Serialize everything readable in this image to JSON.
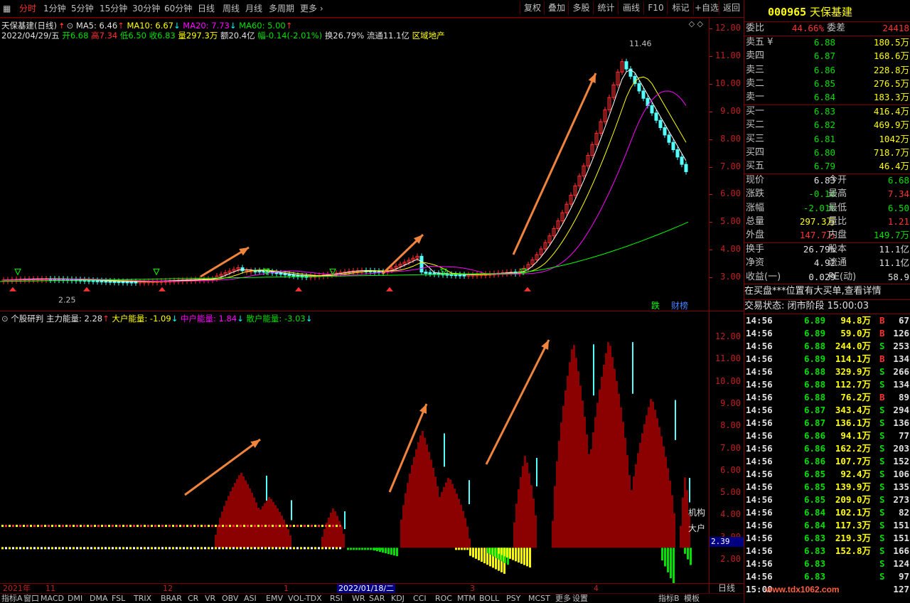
{
  "toolbar": {
    "tabs": [
      "分时",
      "1分钟",
      "5分钟",
      "15分钟",
      "30分钟",
      "60分钟",
      "日线",
      "周线",
      "月线",
      "多周期",
      "更多"
    ],
    "buttons": [
      "复权",
      "叠加",
      "多股",
      "统计",
      "画线",
      "F10",
      "标记",
      "+自选",
      "返回"
    ]
  },
  "main": {
    "title": "天保基建(日线)",
    "ma5": "MA5: 6.46",
    "ma10": "MA10: 6.67",
    "ma20": "MA20: 7.73",
    "ma60": "MA60: 5.00",
    "date": "2022/04/29/五",
    "open": "开6.68",
    "high": "高7.34",
    "low": "低6.50",
    "close": "收6.83",
    "vol": "量297.3万",
    "amount": "额20.4亿",
    "change": "幅-0.14(-2.01%)",
    "turnover": "换26.79%",
    "float": "流通11.1亿",
    "sector": "区域地产",
    "high_marker": "11.46",
    "low_marker": "2.25",
    "corner_labels": [
      "跌",
      "财榜"
    ]
  },
  "sub": {
    "title": "个股研判",
    "main_energy": "主力能量: 2.28",
    "big_energy": "大户能量: -1.09",
    "mid_energy": "中户能量: 1.84",
    "small_energy": "散户能量: -3.03",
    "label_jigou": "机构",
    "label_dahu": "大户",
    "current": "2.39"
  },
  "yaxis_main": [
    "12.00",
    "11.00",
    "10.00",
    "9.00",
    "8.00",
    "7.00",
    "6.00",
    "5.00",
    "4.00",
    "3.00"
  ],
  "yaxis_sub": [
    "12.00",
    "11.00",
    "10.00",
    "9.00",
    "8.00",
    "7.00",
    "6.00",
    "5.00",
    "4.00",
    "3.00",
    "2.00"
  ],
  "timebar": {
    "labels": [
      "2021年",
      "11",
      "12",
      "1",
      "2022/01/18/二",
      "3",
      "4"
    ],
    "period": "日线"
  },
  "bottom_tabs": [
    "指标A",
    "窗口",
    "MACD",
    "DMI",
    "DMA",
    "FSL",
    "TRIX",
    "BRAR",
    "CR",
    "VR",
    "OBV",
    "ASI",
    "EMV",
    "VOL-TDX",
    "RSI",
    "WR",
    "SAR",
    "KDJ",
    "CCI",
    "ROC",
    "MTM",
    "BOLL",
    "PSY",
    "MCST",
    "更多",
    "设置",
    "指标B",
    "模板"
  ],
  "quote": {
    "code": "000965",
    "name": "天保基建",
    "weibi_label": "委比",
    "weibi": "44.66%",
    "weicha_label": "委差",
    "weicha": "24418",
    "asks": [
      {
        "label": "卖五",
        "mark": "¥",
        "price": "6.88",
        "vol": "180.5万"
      },
      {
        "label": "卖四",
        "mark": "",
        "price": "6.87",
        "vol": "168.6万"
      },
      {
        "label": "卖三",
        "mark": "",
        "price": "6.86",
        "vol": "228.8万"
      },
      {
        "label": "卖二",
        "mark": "",
        "price": "6.85",
        "vol": "276.5万"
      },
      {
        "label": "卖一",
        "mark": "",
        "price": "6.84",
        "vol": "183.3万"
      }
    ],
    "bids": [
      {
        "label": "买一",
        "price": "6.83",
        "vol": "416.4万"
      },
      {
        "label": "买二",
        "price": "6.82",
        "vol": "469.9万"
      },
      {
        "label": "买三",
        "price": "6.81",
        "vol": "1042万"
      },
      {
        "label": "买四",
        "price": "6.80",
        "vol": "718.7万"
      },
      {
        "label": "买五",
        "price": "6.79",
        "vol": "46.4万"
      }
    ],
    "stats": [
      {
        "l1": "现价",
        "v1": "6.83",
        "l2": "今开",
        "v2": "6.68",
        "c1": "white",
        "c2": "green"
      },
      {
        "l1": "涨跌",
        "v1": "-0.14",
        "l2": "最高",
        "v2": "7.34",
        "c1": "green",
        "c2": "red"
      },
      {
        "l1": "涨幅",
        "v1": "-2.01%",
        "l2": "最低",
        "v2": "6.50",
        "c1": "green",
        "c2": "green"
      },
      {
        "l1": "总量",
        "v1": "297.3万",
        "l2": "量比",
        "v2": "1.21",
        "c1": "yellow",
        "c2": "red"
      },
      {
        "l1": "外盘",
        "v1": "147.7万",
        "l2": "内盘",
        "v2": "149.7万",
        "c1": "red",
        "c2": "green"
      }
    ],
    "stats2": [
      {
        "l1": "换手",
        "v1": "26.79%",
        "l2": "股本",
        "v2": "11.1亿"
      },
      {
        "l1": "净资",
        "v1": "4.92",
        "l2": "流通",
        "v2": "11.1亿"
      },
      {
        "l1": "收益(一)",
        "v1": "0.029",
        "l2": "PE(动)",
        "v2": "58.9"
      }
    ],
    "notice": "在买盘***位置有大买单,查看详情",
    "status": "交易状态: 闭市阶段 15:00:03",
    "ticks": [
      {
        "t": "14:56",
        "p": "6.89",
        "v": "94.8万",
        "s": "B",
        "n": "67"
      },
      {
        "t": "14:56",
        "p": "6.89",
        "v": "59.0万",
        "s": "B",
        "n": "126"
      },
      {
        "t": "14:56",
        "p": "6.88",
        "v": "244.0万",
        "s": "S",
        "n": "253"
      },
      {
        "t": "14:56",
        "p": "6.89",
        "v": "114.1万",
        "s": "B",
        "n": "134"
      },
      {
        "t": "14:56",
        "p": "6.88",
        "v": "329.9万",
        "s": "S",
        "n": "266"
      },
      {
        "t": "14:56",
        "p": "6.88",
        "v": "112.7万",
        "s": "S",
        "n": "134"
      },
      {
        "t": "14:56",
        "p": "6.88",
        "v": "76.2万",
        "s": "B",
        "n": "89"
      },
      {
        "t": "14:56",
        "p": "6.87",
        "v": "343.4万",
        "s": "S",
        "n": "294"
      },
      {
        "t": "14:56",
        "p": "6.87",
        "v": "136.1万",
        "s": "S",
        "n": "136"
      },
      {
        "t": "14:56",
        "p": "6.86",
        "v": "94.1万",
        "s": "S",
        "n": "77"
      },
      {
        "t": "14:56",
        "p": "6.86",
        "v": "162.2万",
        "s": "S",
        "n": "203"
      },
      {
        "t": "14:56",
        "p": "6.86",
        "v": "107.7万",
        "s": "S",
        "n": "152"
      },
      {
        "t": "14:56",
        "p": "6.85",
        "v": "92.4万",
        "s": "S",
        "n": "106"
      },
      {
        "t": "14:56",
        "p": "6.85",
        "v": "139.9万",
        "s": "S",
        "n": "135"
      },
      {
        "t": "14:56",
        "p": "6.85",
        "v": "209.0万",
        "s": "S",
        "n": "273"
      },
      {
        "t": "14:56",
        "p": "6.84",
        "v": "102.1万",
        "s": "S",
        "n": "82"
      },
      {
        "t": "14:56",
        "p": "6.84",
        "v": "117.3万",
        "s": "S",
        "n": "151"
      },
      {
        "t": "14:56",
        "p": "6.83",
        "v": "219.3万",
        "s": "S",
        "n": "151"
      },
      {
        "t": "14:56",
        "p": "6.83",
        "v": "152.8万",
        "s": "S",
        "n": "166"
      },
      {
        "t": "14:56",
        "p": "6.83",
        "v": "",
        "s": "S",
        "n": "124"
      },
      {
        "t": "14:56",
        "p": "6.83",
        "v": "",
        "s": "S",
        "n": "97"
      },
      {
        "t": "15:00",
        "p": "",
        "v": "",
        "s": "",
        "n": "127"
      }
    ],
    "watermark": "www.tdx1062.com"
  },
  "colors": {
    "accent": "#ff3232",
    "up": "#ff3232",
    "down": "#00e000",
    "border": "#800000",
    "arrow": "#f0843c"
  }
}
